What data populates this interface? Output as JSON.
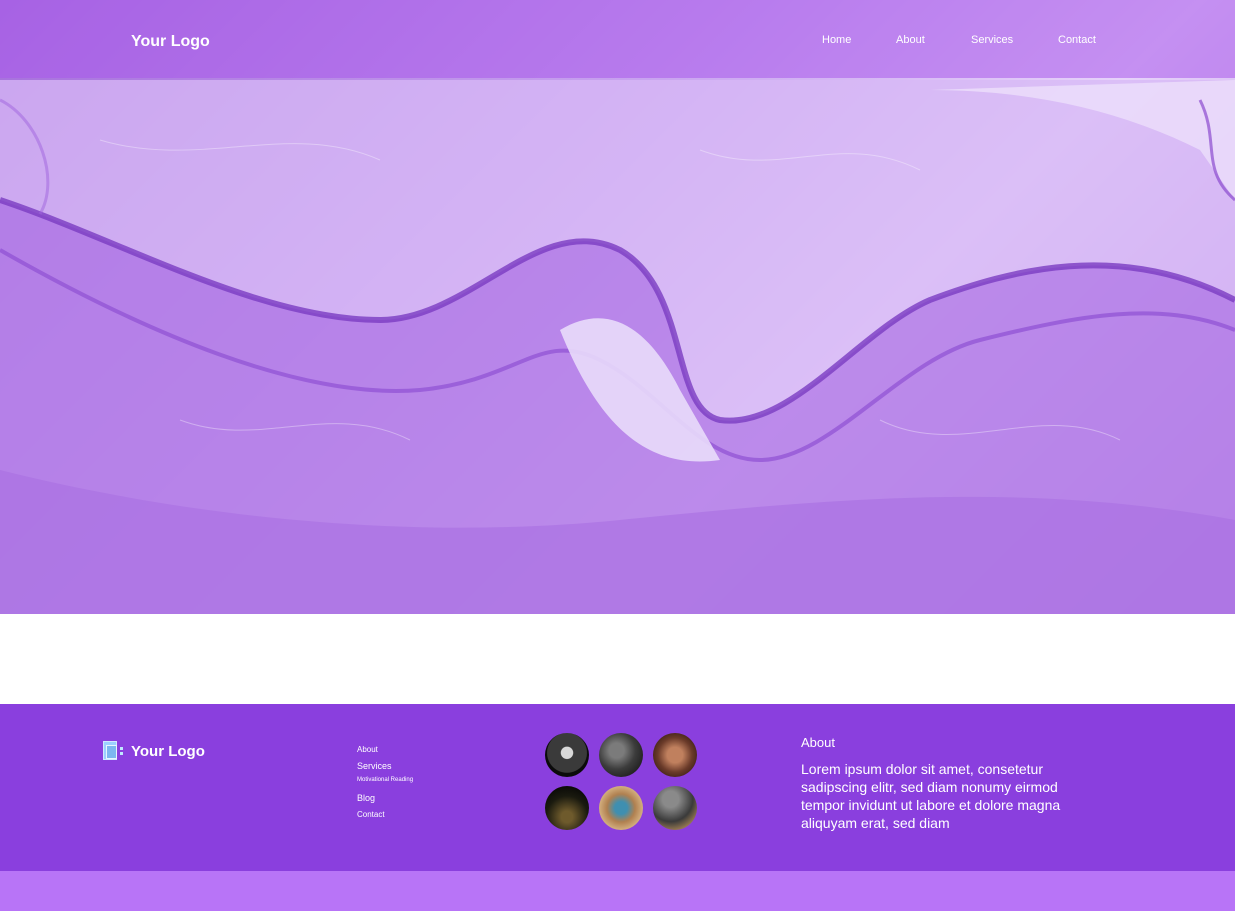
{
  "header": {
    "logo": "Your Logo",
    "nav": [
      "Home",
      "About",
      "Services",
      "Contact"
    ]
  },
  "hero": {
    "image": "purple-translucent-fabric-background"
  },
  "footer": {
    "logo": "Your Logo",
    "logo_icon": "document-icon",
    "links": [
      "About",
      "Services",
      "Motivational Reading",
      "Blog",
      "Contact"
    ],
    "gallery": [
      "event-photo-1",
      "crowd-photo-2",
      "audience-photo-3",
      "night-crowd-photo-4",
      "speaker-photo-5",
      "stage-photo-6"
    ],
    "about_title": "About",
    "about_text": "Lorem ipsum dolor sit amet, consetetur sadipscing elitr, sed diam nonumy eirmod tempor invidunt ut labore et dolore magna aliquyam erat, sed diam"
  },
  "colors": {
    "footer_bg": "#8a3fde",
    "bottom_strip": "#b874f7",
    "header_overlay": "#aa5aeb"
  }
}
